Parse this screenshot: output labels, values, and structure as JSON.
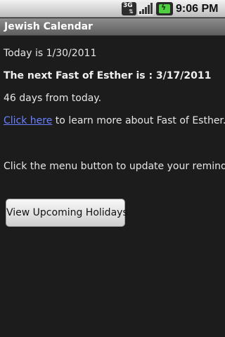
{
  "status_bar": {
    "network_label": "3G",
    "network_arrows": "⇅",
    "time": "9:06 PM",
    "signal_color": "#3a3a3a",
    "battery_color": "#50d040"
  },
  "app": {
    "title": "Jewish Calendar"
  },
  "content": {
    "today_text": "Today is 1/30/2011",
    "next_fast_text": "The next Fast of Esther is : 3/17/2011",
    "days_text": "46 days from today.",
    "link_text": "Click here",
    "link_suffix": " to learn more about Fast of Esther.",
    "menu_hint": "Click the menu button to update your reminders."
  },
  "buttons": {
    "upcoming_holidays": "View Upcoming Holidays"
  },
  "colors": {
    "background": "#1c1c1c",
    "link": "#6b80ff",
    "text": "#e6e6e6"
  }
}
